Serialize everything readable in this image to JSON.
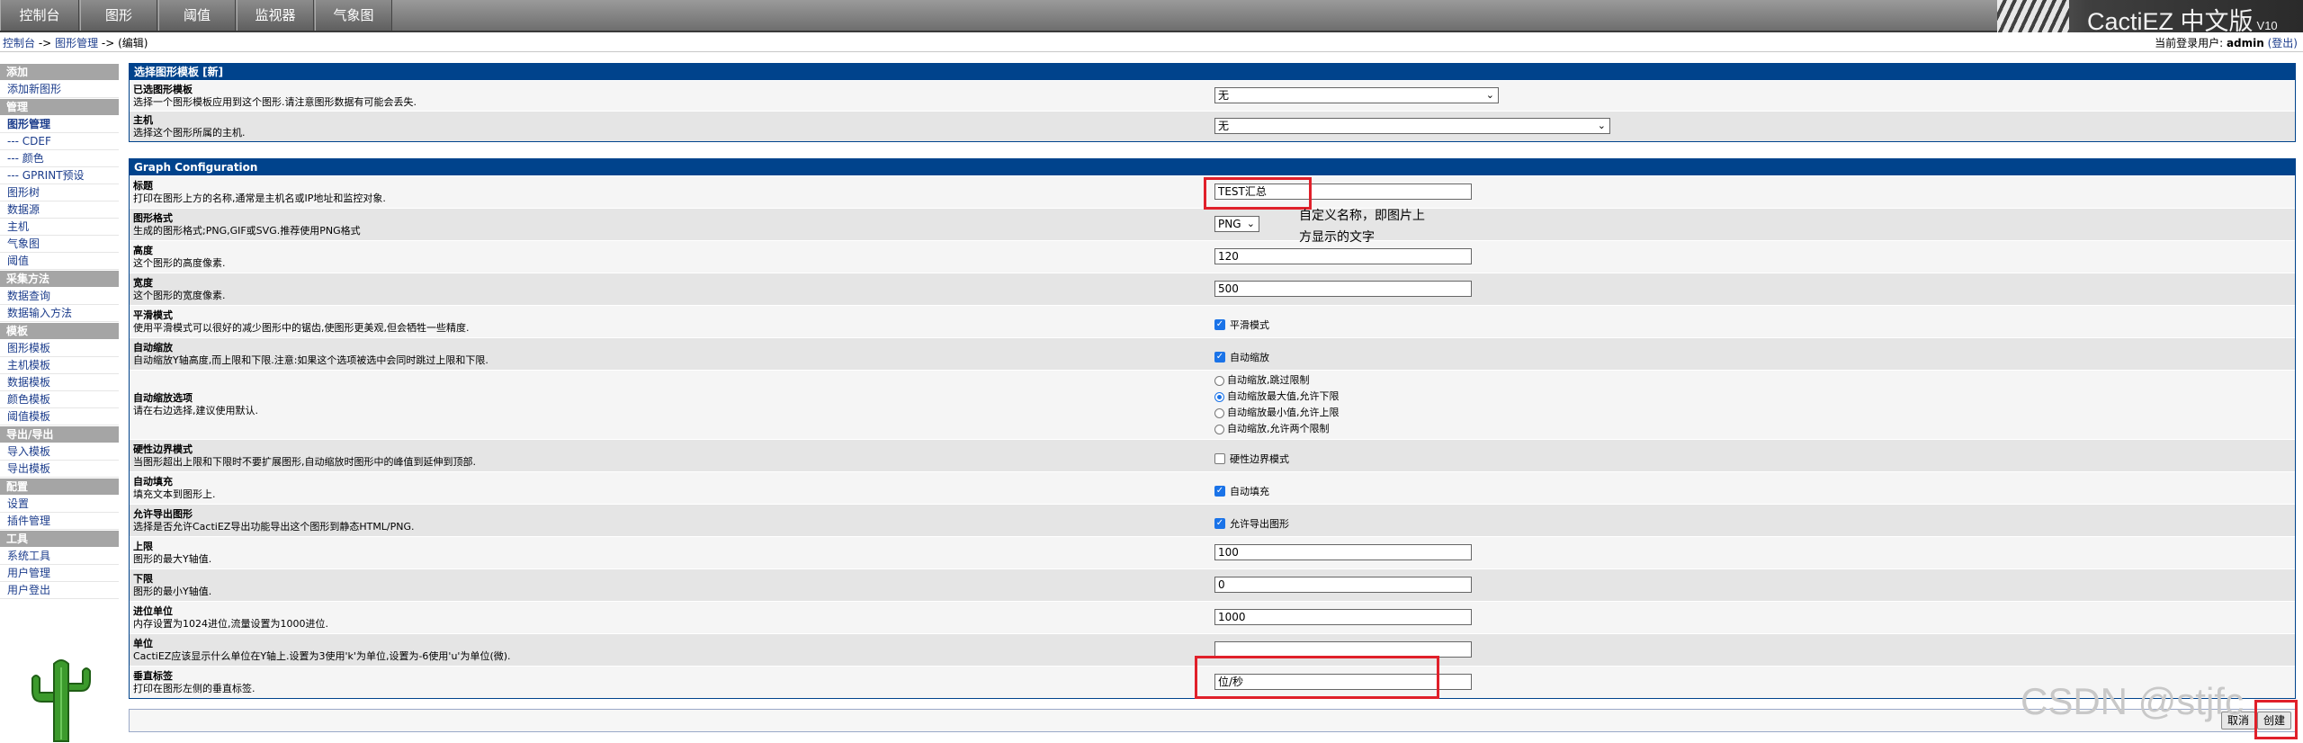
{
  "topbar": {
    "tabs": [
      "控制台",
      "图形",
      "阈值",
      "监视器",
      "气象图"
    ],
    "brand": "CactiEZ 中文版",
    "brand_version": "V10"
  },
  "breadcrumb": {
    "home": "控制台",
    "sep1": "->",
    "graphs": "图形管理",
    "sep2": "->",
    "current": "(编辑)"
  },
  "user": {
    "prefix": "当前登录用户:",
    "name": "admin",
    "logout": "(登出)"
  },
  "sidebar": {
    "add_header": "添加",
    "add_graph": "添加新图形",
    "manage_header": "管理",
    "manage_items": [
      "图形管理",
      "--- CDEF",
      "--- 颜色",
      "--- GPRINT预设",
      "图形树",
      "数据源",
      "主机",
      "气象图",
      "阈值"
    ],
    "collect_header": "采集方法",
    "collect_items": [
      "数据查询",
      "数据输入方法"
    ],
    "template_header": "模板",
    "template_items": [
      "图形模板",
      "主机模板",
      "数据模板",
      "颜色模板",
      "阈值模板"
    ],
    "io_header": "导出/导出",
    "io_items": [
      "导入模板",
      "导出模板"
    ],
    "config_header": "配置",
    "config_items": [
      "设置",
      "插件管理"
    ],
    "tools_header": "工具",
    "tools_items": [
      "系统工具",
      "用户管理",
      "用户登出"
    ]
  },
  "template_panel": {
    "title": "选择图形模板 [新]",
    "fields": [
      {
        "label": "已选图形模板",
        "desc": "选择一个图形模板应用到这个图形.请注意图形数据有可能会丢失.",
        "value": "无"
      },
      {
        "label": "主机",
        "desc": "选择这个图形所属的主机.",
        "value": "无"
      }
    ]
  },
  "config_panel": {
    "title": "Graph Configuration",
    "title_field": {
      "label": "标题",
      "desc": "打印在图形上方的名称,通常是主机名或IP地址和监控对象.",
      "value": "TEST汇总"
    },
    "format_field": {
      "label": "图形格式",
      "desc": "生成的图形格式;PNG,GIF或SVG.推荐使用PNG格式",
      "value": "PNG"
    },
    "height_field": {
      "label": "高度",
      "desc": "这个图形的高度像素.",
      "value": "120"
    },
    "width_field": {
      "label": "宽度",
      "desc": "这个图形的宽度像素.",
      "value": "500"
    },
    "smooth_field": {
      "label": "平滑模式",
      "desc": "使用平滑模式可以很好的减少图形中的锯齿,使图形更美观,但会牺牲一些精度.",
      "check_label": "平滑模式"
    },
    "autoscale_field": {
      "label": "自动缩放",
      "desc": "自动缩放Y轴高度,而上限和下限.注意:如果这个选项被选中会同时跳过上限和下限.",
      "check_label": "自动缩放"
    },
    "autoscale_opts_field": {
      "label": "自动缩放选项",
      "desc": "请在右边选择,建议使用默认.",
      "options": [
        "自动缩放,跳过限制",
        "自动缩放最大值,允许下限",
        "自动缩放最小值,允许上限",
        "自动缩放,允许两个限制"
      ]
    },
    "rigid_field": {
      "label": "硬性边界模式",
      "desc": "当图形超出上限和下限时不要扩展图形,自动缩放时图形中的峰值到延伸到顶部.",
      "check_label": "硬性边界模式"
    },
    "fill_field": {
      "label": "自动填充",
      "desc": "填充文本到图形上.",
      "check_label": "自动填充"
    },
    "export_field": {
      "label": "允许导出图形",
      "desc": "选择是否允许CactiEZ导出功能导出这个图形到静态HTML/PNG.",
      "check_label": "允许导出图形"
    },
    "upper_field": {
      "label": "上限",
      "desc": "图形的最大Y轴值.",
      "value": "100"
    },
    "lower_field": {
      "label": "下限",
      "desc": "图形的最小Y轴值.",
      "value": "0"
    },
    "base_field": {
      "label": "进位单位",
      "desc": "内存设置为1024进位,流量设置为1000进位.",
      "value": "1000"
    },
    "unit_field": {
      "label": "单位",
      "desc": "CactiEZ应该显示什么单位在Y轴上.设置为3使用'k'为单位,设置为-6使用'u'为单位(微).",
      "value": ""
    },
    "vlabel_field": {
      "label": "垂直标签",
      "desc": "打印在图形左侧的垂直标签.",
      "value": "位/秒"
    }
  },
  "annotation": {
    "line1": "自定义名称，即图片上",
    "line2": "方显示的文字"
  },
  "buttons": {
    "cancel": "取消",
    "create": "创建"
  },
  "watermark": "CSDN @stjfc"
}
